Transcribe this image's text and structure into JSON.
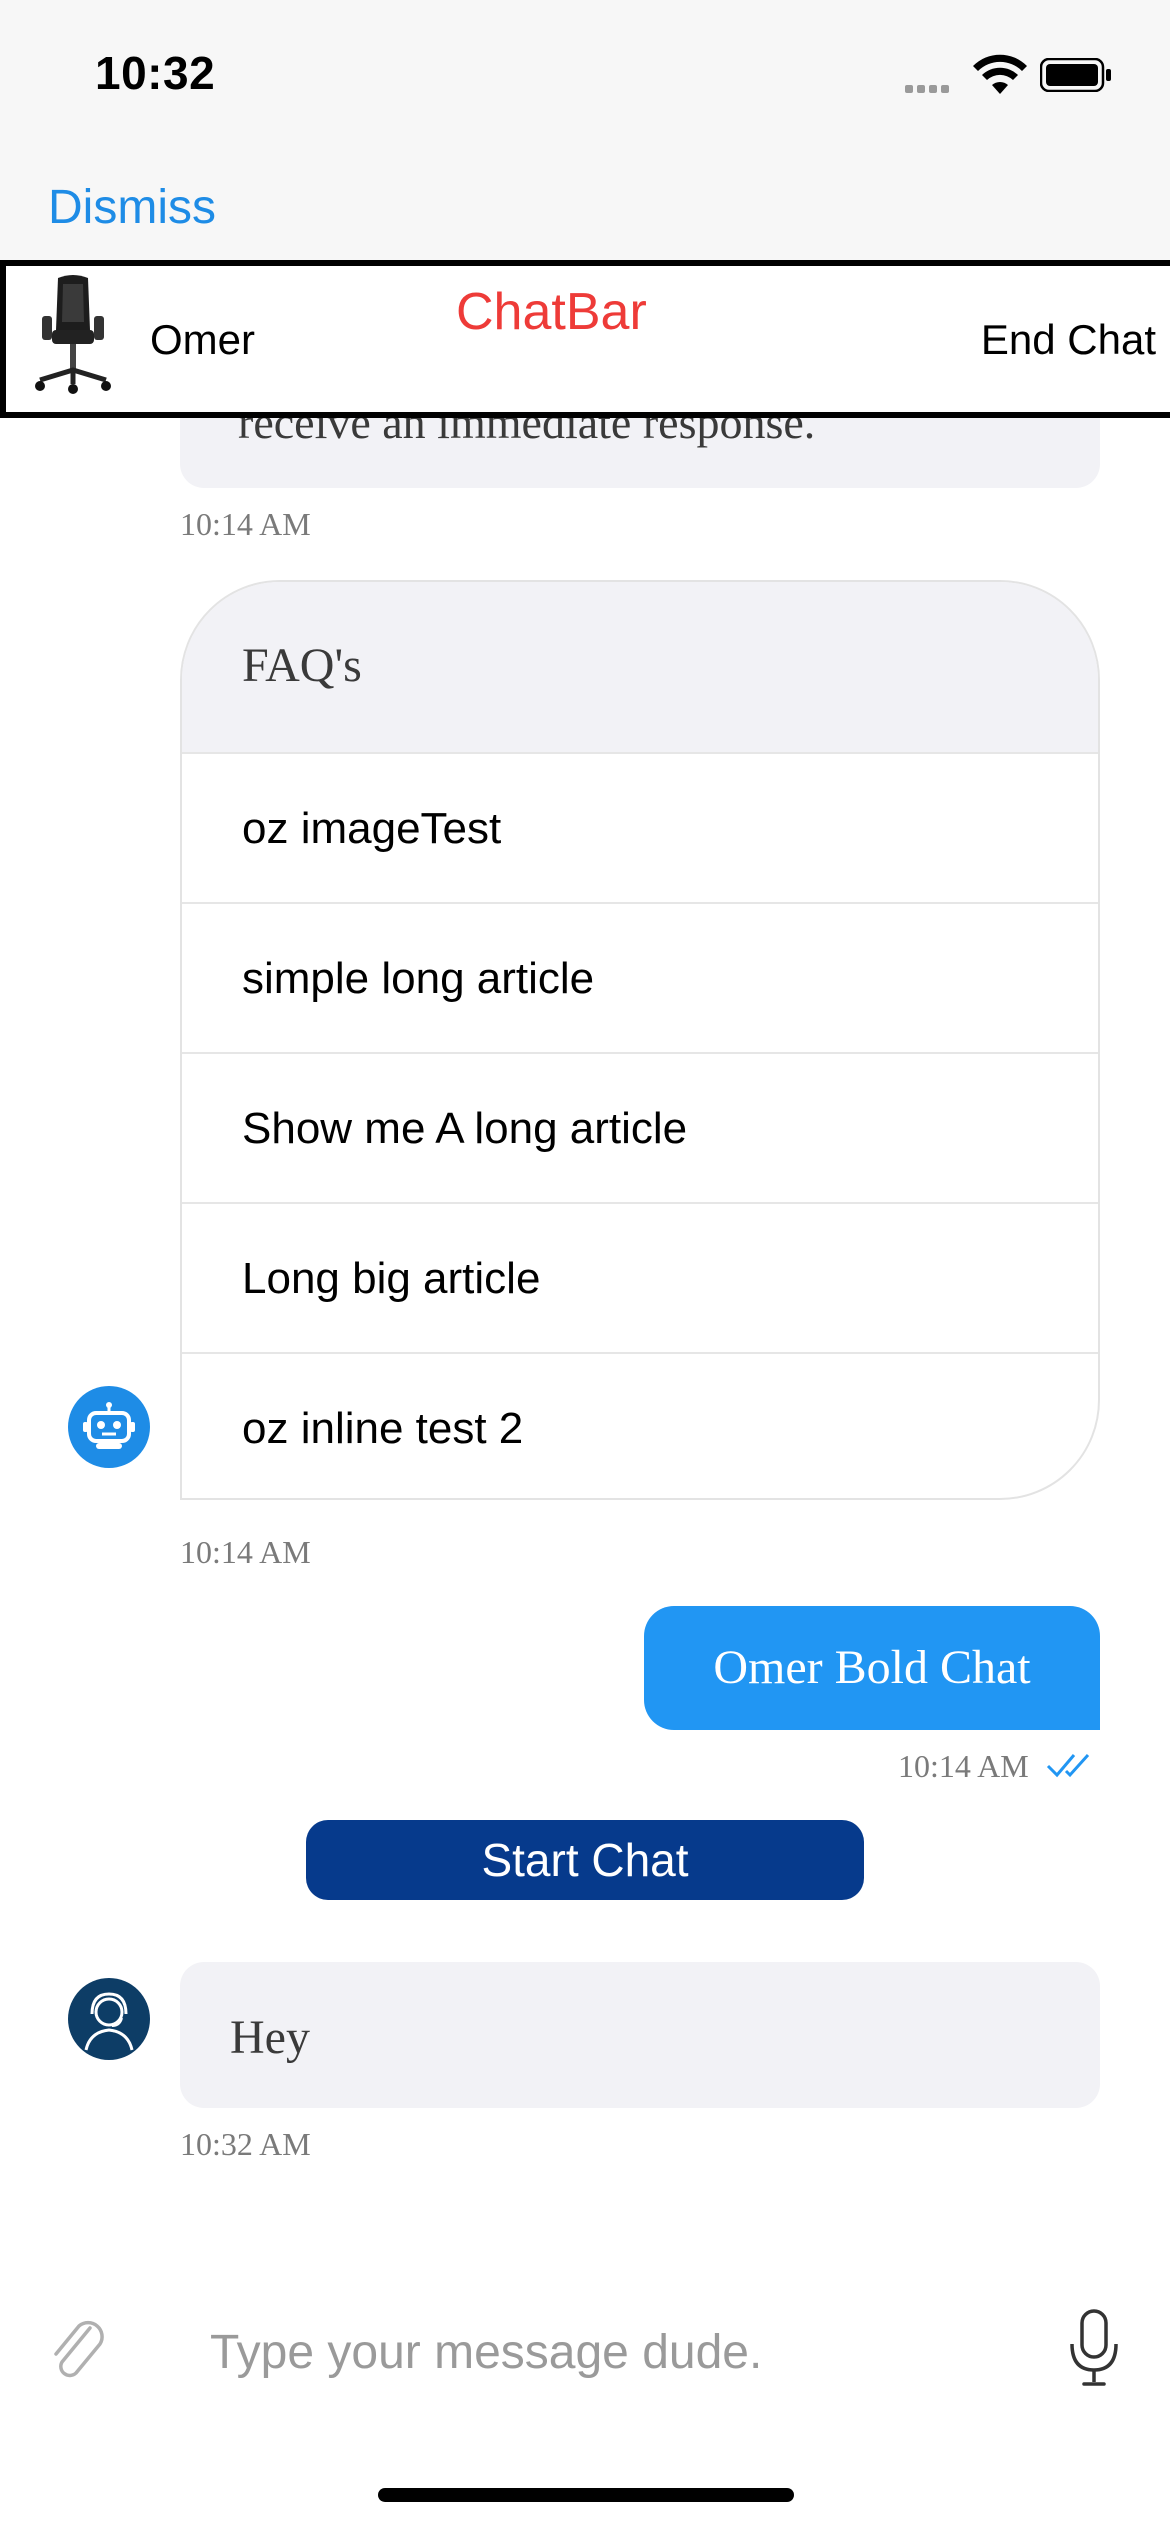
{
  "status_bar": {
    "time": "10:32"
  },
  "nav": {
    "dismiss_label": "Dismiss"
  },
  "chatbar": {
    "agent_name": "Omer",
    "title": "ChatBar",
    "end_chat_label": "End Chat",
    "title_color": "#ee3b38"
  },
  "messages": {
    "partial_text": "receive an immediate response.",
    "partial_timestamp": "10:14 AM",
    "faq": {
      "title": "FAQ's",
      "items": [
        {
          "label": "oz imageTest"
        },
        {
          "label": "simple long article"
        },
        {
          "label": "Show me A long article"
        },
        {
          "label": "Long big article"
        },
        {
          "label": "oz inline test 2"
        }
      ],
      "timestamp": "10:14 AM"
    },
    "user_message": {
      "text": "Omer Bold Chat",
      "timestamp": "10:14 AM"
    },
    "start_chat_label": "Start Chat",
    "agent_message": {
      "text": "Hey",
      "timestamp": "10:32 AM"
    }
  },
  "input": {
    "placeholder": "Type your message dude."
  },
  "colors": {
    "accent_blue": "#2196f3",
    "link_blue": "#1e8ce6",
    "start_chat_navy": "#063a8c",
    "bubble_gray": "#f2f2f6"
  },
  "icons": [
    "signal-icon",
    "wifi-icon",
    "battery-icon",
    "chair-avatar",
    "bot-icon",
    "double-check-icon",
    "agent-icon",
    "paperclip-icon",
    "microphone-icon"
  ]
}
